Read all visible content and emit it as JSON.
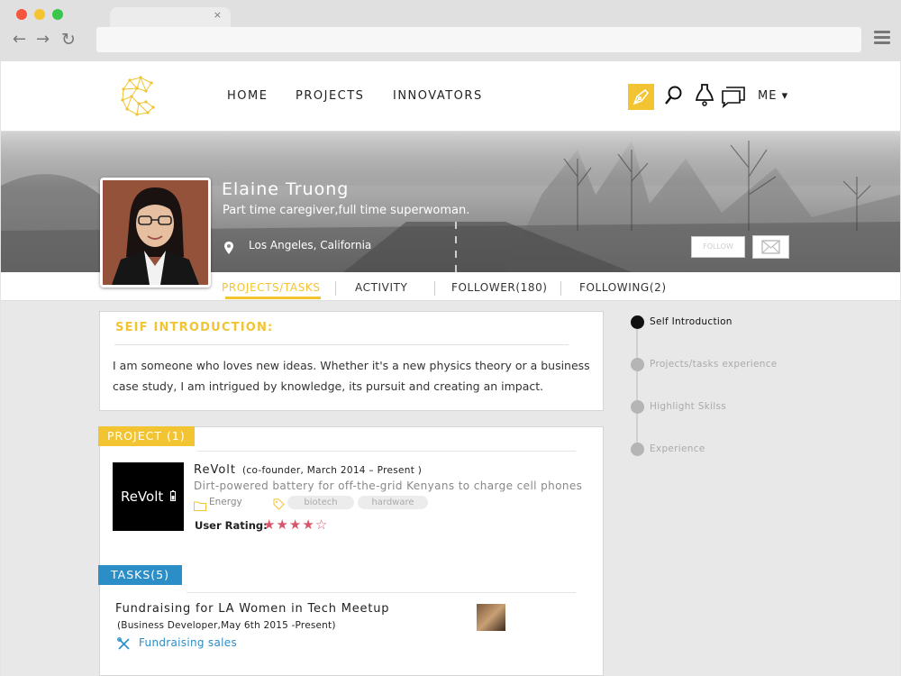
{
  "browser": {
    "tab_close": "×",
    "back": "←",
    "forward": "→",
    "reload": "↻"
  },
  "nav": {
    "links": [
      "HOME",
      "PROJECTS",
      "INNOVATORS"
    ],
    "me_label": "ME ▾",
    "accent_color": "#f2c432"
  },
  "profile": {
    "name": "Elaine Truong",
    "tagline": "Part time caregiver,full time superwoman.",
    "location": "Los Angeles, California",
    "follow_label": "FOLLOW"
  },
  "subnav": {
    "tabs": [
      "PROJECTS/TASKS",
      "ACTIVITY",
      "FOLLOWER(180)",
      "FOLLOWING(2)"
    ],
    "active_index": 0
  },
  "intro": {
    "title": "SEIF INTRODUCTION:",
    "text": "I am someone who loves new ideas. Whether it's a new physics theory or a business case study, I am intrigued by knowledge, its pursuit and creating an impact."
  },
  "project_section": {
    "label": "PROJECT (1)",
    "project": {
      "logo_text": "ReVolt",
      "name": "ReVolt",
      "role": "(co-founder, March 2014 – Present )",
      "description": "Dirt-powered battery for off-the-grid Kenyans to charge cell phones",
      "category": "Energy",
      "tags": [
        "biotech",
        "hardware"
      ],
      "rating_label": "User Rating:",
      "rating": 4,
      "rating_max": 5,
      "rating_color": "#d9556b"
    }
  },
  "tasks_section": {
    "label": "TASKS(5)",
    "label_color": "#2b8ec7",
    "task": {
      "name": "Fundraising for LA Women in Tech Meetup",
      "role": "(Business Developer,May 6th 2015 -Present)",
      "skill": "Fundraising sales"
    }
  },
  "timeline": {
    "items": [
      "Self Introduction",
      "Projects/tasks experience",
      "Highlight Skilss",
      "Experience"
    ],
    "active_index": 0
  }
}
